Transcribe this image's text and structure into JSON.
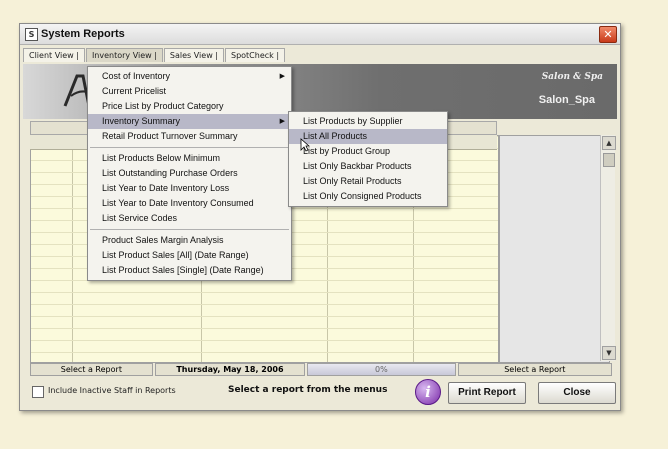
{
  "window": {
    "title": "System Reports",
    "icon_glyph": "S",
    "close_glyph": "✕"
  },
  "tabs": [
    {
      "label": "Client View |"
    },
    {
      "label": "Inventory View |"
    },
    {
      "label": "Sales View |"
    },
    {
      "label": "SpotCheck |"
    }
  ],
  "header": {
    "tagline": "Salon & Spa",
    "salon_name": "Salon_Spa"
  },
  "inventory_menu": [
    {
      "label": "Cost of Inventory",
      "arrow": "▶"
    },
    {
      "label": "Current Pricelist"
    },
    {
      "label": "Price List by Product Category"
    },
    {
      "label": "Inventory Summary",
      "arrow": "▶"
    },
    {
      "label": "Retail Product Turnover Summary"
    },
    {
      "label": "List Products Below Minimum"
    },
    {
      "label": "List Outstanding Purchase Orders"
    },
    {
      "label": "List Year to Date Inventory Loss"
    },
    {
      "label": "List Year to Date Inventory Consumed"
    },
    {
      "label": "List Service Codes"
    },
    {
      "label": "Product Sales Margin Analysis"
    },
    {
      "label": "List Product Sales [All] (Date Range)"
    },
    {
      "label": "List Product Sales [Single] (Date Range)"
    }
  ],
  "submenu": [
    {
      "label": "List Products by Supplier"
    },
    {
      "label": "List All Products"
    },
    {
      "label": "List by Product Group"
    },
    {
      "label": "List Only Backbar Products"
    },
    {
      "label": "List Only Retail Products"
    },
    {
      "label": "List Only Consigned Products"
    }
  ],
  "status": {
    "left": "Select a Report",
    "date": "Thursday, May 18, 2006",
    "progress": "0%",
    "right": "Select a Report"
  },
  "footer": {
    "checkbox_label": "Include Inactive Staff in Reports",
    "message": "Select a report from the menus",
    "info_glyph": "i",
    "print_label": "Print Report",
    "close_label": "Close"
  },
  "scroll": {
    "up": "▲",
    "down": "▼"
  },
  "colors": {
    "grid": "#fbfadc",
    "highlight": "#b8b8c8",
    "close_button": "#d84a2a",
    "info_icon": "#7a2aa8"
  }
}
